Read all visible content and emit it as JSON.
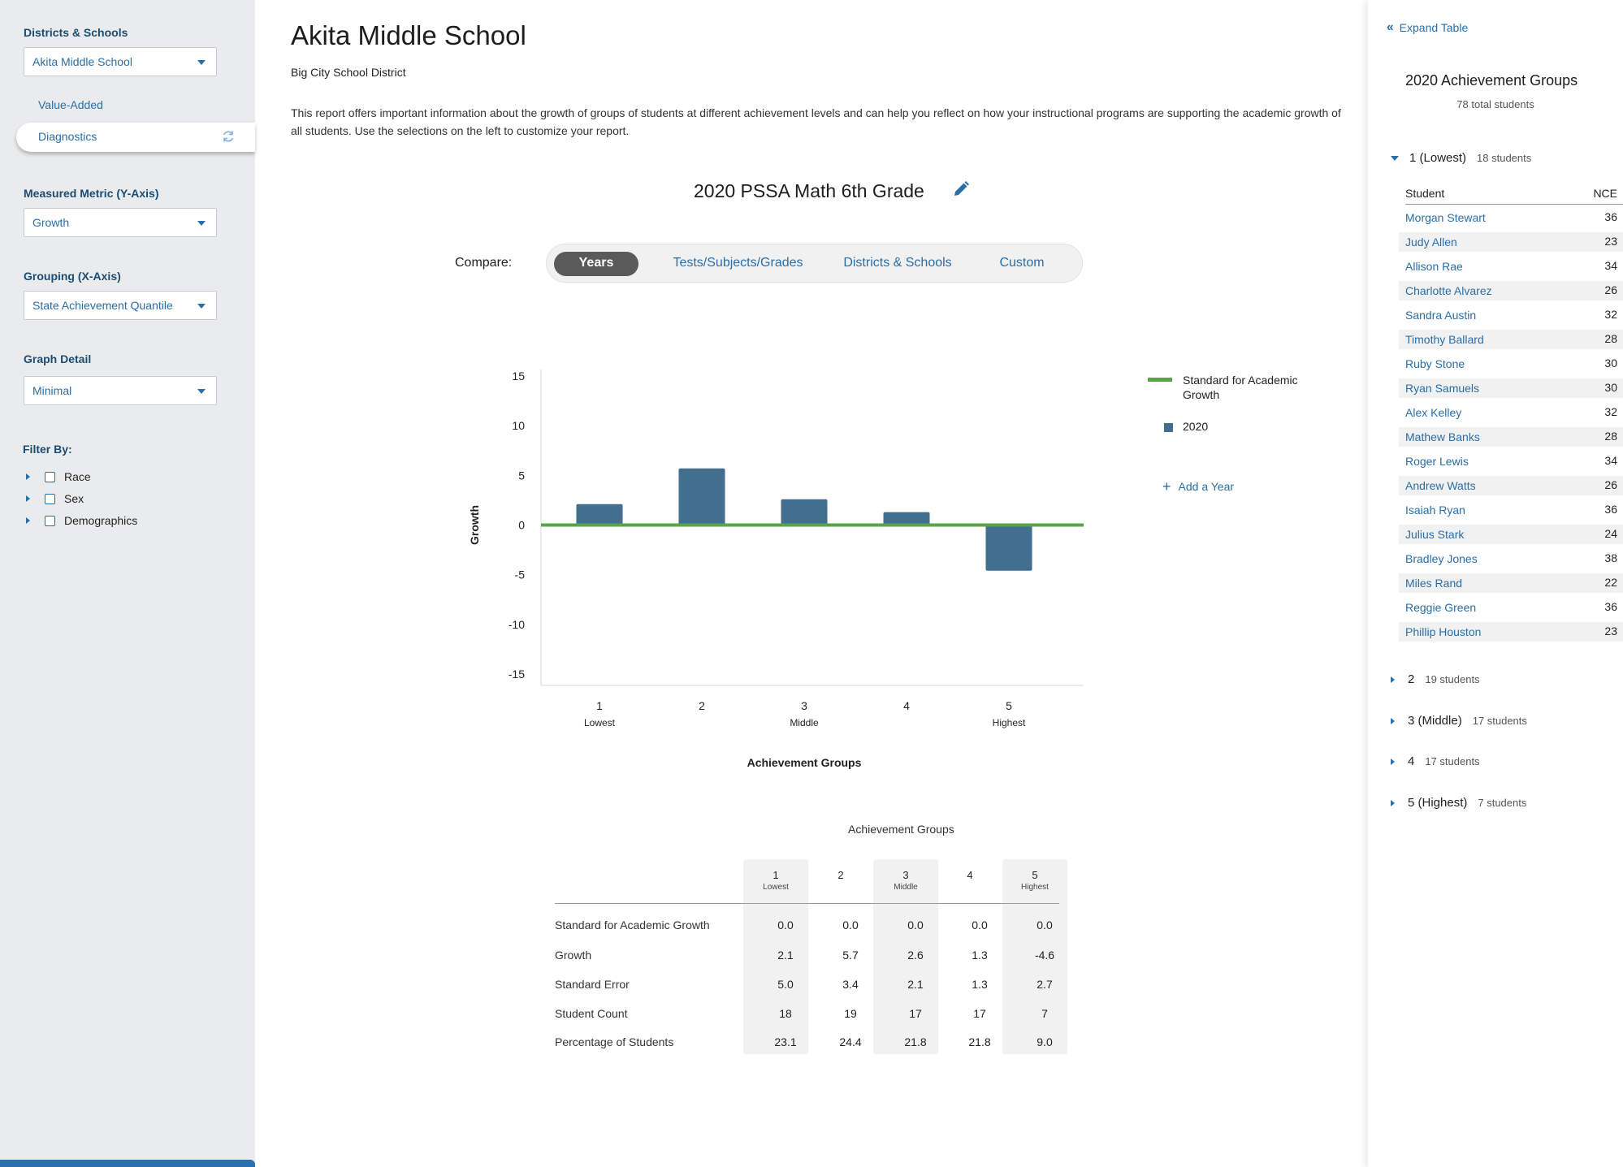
{
  "sidebar": {
    "districts_label": "Districts & Schools",
    "school_select": "Akita Middle School",
    "nav": [
      "Value-Added",
      "Diagnostics"
    ],
    "metric_label": "Measured Metric (Y-Axis)",
    "metric_select": "Growth",
    "grouping_label": "Grouping (X-Axis)",
    "grouping_select": "State Achievement Quantile",
    "detail_label": "Graph Detail",
    "detail_select": "Minimal",
    "filter_label": "Filter By:",
    "filters": [
      "Race",
      "Sex",
      "Demographics"
    ]
  },
  "main": {
    "title": "Akita Middle School",
    "district": "Big City School District",
    "intro": "This report offers important information about the growth of groups of students at different achievement levels and can help you reflect on how your instructional programs are supporting the academic growth of all students. Use the selections on the left to customize your report.",
    "report_title": "2020 PSSA Math 6th Grade",
    "compare_label": "Compare:",
    "compare_options": [
      "Years",
      "Tests/Subjects/Grades",
      "Districts & Schools",
      "Custom"
    ],
    "legend": {
      "standard": "Standard for Academic Growth",
      "year": "2020",
      "add_year": "Add a Year"
    }
  },
  "chart_data": {
    "type": "bar",
    "categories": [
      "1",
      "2",
      "3",
      "4",
      "5"
    ],
    "category_sublabels": [
      "Lowest",
      "",
      "Middle",
      "",
      "Highest"
    ],
    "series": [
      {
        "name": "2020",
        "values": [
          2.1,
          5.7,
          2.6,
          1.3,
          -4.6
        ],
        "color": "#426e8f"
      }
    ],
    "reference_line": {
      "name": "Standard for Academic Growth",
      "value": 0,
      "color": "#58a447"
    },
    "xlabel": "Achievement Groups",
    "ylabel": "Growth",
    "ylim": [
      -15,
      15
    ],
    "yticks": [
      15,
      10,
      5,
      0,
      -5,
      -10,
      -15
    ]
  },
  "table": {
    "caption": "Achievement Groups",
    "columns": [
      {
        "num": "1",
        "sub": "Lowest"
      },
      {
        "num": "2",
        "sub": ""
      },
      {
        "num": "3",
        "sub": "Middle"
      },
      {
        "num": "4",
        "sub": ""
      },
      {
        "num": "5",
        "sub": "Highest"
      }
    ],
    "rows": [
      {
        "label": "Standard for Academic Growth",
        "values": [
          "0.0",
          "0.0",
          "0.0",
          "0.0",
          "0.0"
        ]
      },
      {
        "label": "Growth",
        "values": [
          "2.1",
          "5.7",
          "2.6",
          "1.3",
          "-4.6"
        ]
      },
      {
        "label": "Standard Error",
        "values": [
          "5.0",
          "3.4",
          "2.1",
          "1.3",
          "2.7"
        ]
      },
      {
        "label": "Student Count",
        "values": [
          "18",
          "19",
          "17",
          "17",
          "7"
        ]
      },
      {
        "label": "Percentage of Students",
        "values": [
          "23.1",
          "24.4",
          "21.8",
          "21.8",
          "9.0"
        ]
      }
    ]
  },
  "panel": {
    "expand": "Expand Table",
    "title": "2020 Achievement Groups",
    "total": "78 total students",
    "student_header": "Student",
    "score_header": "NCE",
    "groups": [
      {
        "name": "1 (Lowest)",
        "count": "18 students",
        "expanded": true
      },
      {
        "name": "2",
        "count": "19 students",
        "expanded": false
      },
      {
        "name": "3 (Middle)",
        "count": "17 students",
        "expanded": false
      },
      {
        "name": "4",
        "count": "17 students",
        "expanded": false
      },
      {
        "name": "5 (Highest)",
        "count": "7 students",
        "expanded": false
      }
    ],
    "students": [
      {
        "name": "Morgan Stewart",
        "nce": "36"
      },
      {
        "name": "Judy Allen",
        "nce": "23"
      },
      {
        "name": "Allison Rae",
        "nce": "34"
      },
      {
        "name": "Charlotte Alvarez",
        "nce": "26"
      },
      {
        "name": "Sandra Austin",
        "nce": "32"
      },
      {
        "name": "Timothy Ballard",
        "nce": "28"
      },
      {
        "name": "Ruby Stone",
        "nce": "30"
      },
      {
        "name": "Ryan Samuels",
        "nce": "30"
      },
      {
        "name": "Alex Kelley",
        "nce": "32"
      },
      {
        "name": "Mathew Banks",
        "nce": "28"
      },
      {
        "name": "Roger Lewis",
        "nce": "34"
      },
      {
        "name": "Andrew Watts",
        "nce": "26"
      },
      {
        "name": "Isaiah Ryan",
        "nce": "36"
      },
      {
        "name": "Julius Stark",
        "nce": "24"
      },
      {
        "name": "Bradley Jones",
        "nce": "38"
      },
      {
        "name": "Miles Rand",
        "nce": "22"
      },
      {
        "name": "Reggie Green",
        "nce": "36"
      },
      {
        "name": "Phillip Houston",
        "nce": "23"
      }
    ]
  },
  "colors": {
    "accent": "#2a6ea6",
    "bar": "#426e8f",
    "standard": "#58a447",
    "sidebar_bg": "#eaebec"
  }
}
